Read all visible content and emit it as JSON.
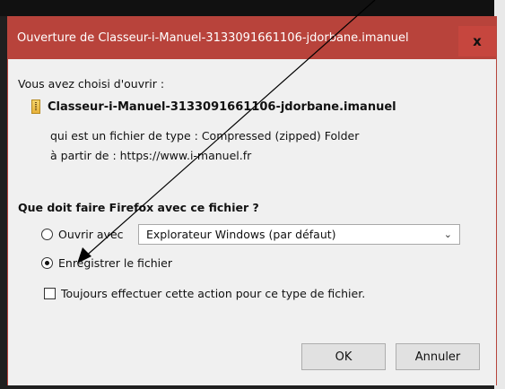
{
  "dialog": {
    "title": "Ouverture de Classeur-i-Manuel-3133091661106-jdorbane.imanuel",
    "close_glyph": "x"
  },
  "content": {
    "intro": "Vous avez choisi d'ouvrir :",
    "filename": "Classeur-i-Manuel-3133091661106-jdorbane.imanuel",
    "file_type_line": "qui est un fichier de type : Compressed (zipped) Folder",
    "from_line": "à partir de : https://www.i-manuel.fr",
    "question": "Que doit faire Firefox avec ce fichier ?"
  },
  "options": {
    "open_with_label": "Ouvrir avec",
    "open_with_app": "Explorateur Windows (par défaut)",
    "save_label": "Enregistrer le fichier",
    "always_label": "Toujours effectuer cette action pour ce type de fichier.",
    "selected": "save",
    "always_checked": false
  },
  "buttons": {
    "ok": "OK",
    "cancel": "Annuler"
  },
  "colors": {
    "titlebar": "#b8433b",
    "annotation_arrow": "#000000"
  },
  "icons": {
    "file": "zip-file-icon",
    "close": "close-icon",
    "dropdown": "chevron-down-icon"
  }
}
